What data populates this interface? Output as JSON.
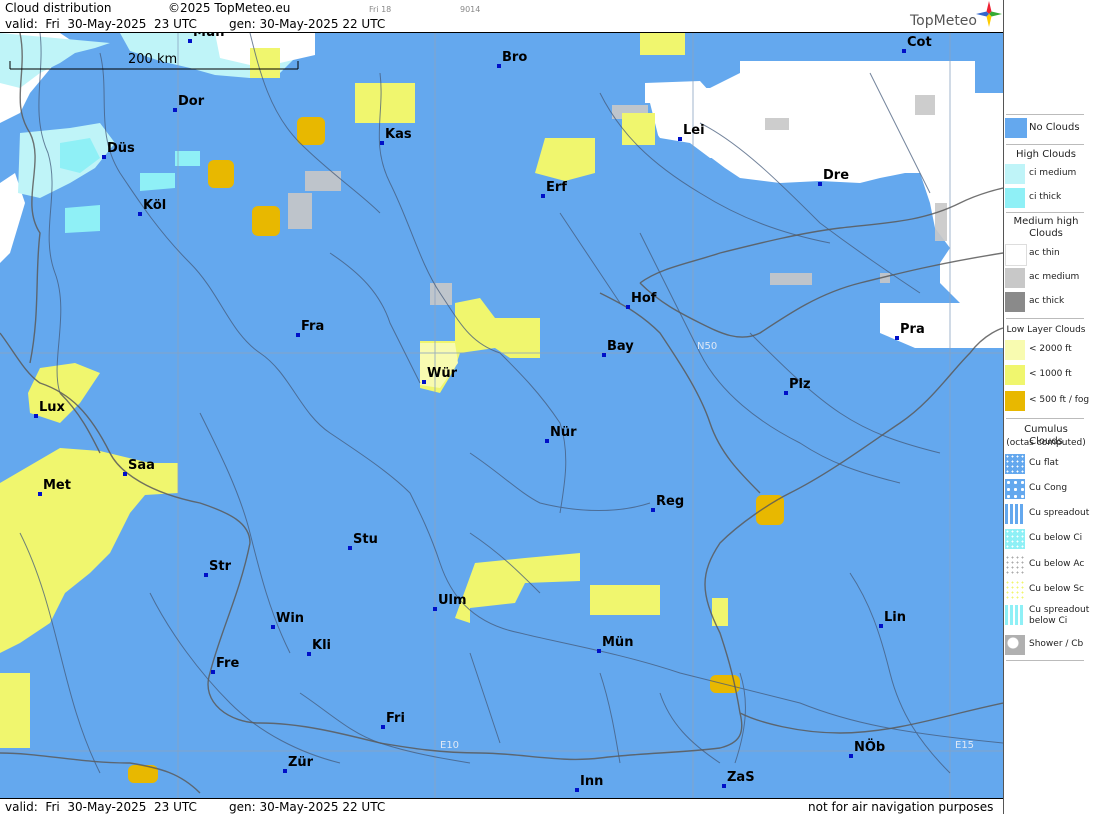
{
  "header": {
    "title": "Cloud distribution",
    "copyright": "©2025 TopMeteo.eu",
    "tiny1": "Fri 18",
    "tiny2": "9014",
    "valid": "valid:  Fri  30-May-2025  23 UTC",
    "gen": "gen: 30-May-2025 22 UTC",
    "logo": "TopMeteo"
  },
  "footer": {
    "valid": "valid:  Fri  30-May-2025  23 UTC",
    "gen": "gen: 30-May-2025 22 UTC",
    "disclaimer": "not for air navigation purposes"
  },
  "map": {
    "scale_label": "200 km",
    "grid_labels": [
      "N50",
      "E10",
      "E15"
    ],
    "cities": [
      {
        "id": "mun1",
        "name": "Mün"
      },
      {
        "id": "cot",
        "name": "Cot"
      },
      {
        "id": "bro",
        "name": "Bro"
      },
      {
        "id": "dor",
        "name": "Dor"
      },
      {
        "id": "kas",
        "name": "Kas"
      },
      {
        "id": "lei",
        "name": "Lei"
      },
      {
        "id": "dus",
        "name": "Düs"
      },
      {
        "id": "erf",
        "name": "Erf"
      },
      {
        "id": "dre",
        "name": "Dre"
      },
      {
        "id": "kol",
        "name": "Köl"
      },
      {
        "id": "hof",
        "name": "Hof"
      },
      {
        "id": "fra",
        "name": "Fra"
      },
      {
        "id": "pra",
        "name": "Pra"
      },
      {
        "id": "bay",
        "name": "Bay"
      },
      {
        "id": "wur",
        "name": "Wür"
      },
      {
        "id": "plz",
        "name": "Plz"
      },
      {
        "id": "lux",
        "name": "Lux"
      },
      {
        "id": "nur",
        "name": "Nür"
      },
      {
        "id": "saa",
        "name": "Saa"
      },
      {
        "id": "met",
        "name": "Met"
      },
      {
        "id": "reg",
        "name": "Reg"
      },
      {
        "id": "stu",
        "name": "Stu"
      },
      {
        "id": "str",
        "name": "Str"
      },
      {
        "id": "ulm",
        "name": "Ulm"
      },
      {
        "id": "win",
        "name": "Win"
      },
      {
        "id": "lin",
        "name": "Lin"
      },
      {
        "id": "kli",
        "name": "Kli"
      },
      {
        "id": "mun2",
        "name": "Mün"
      },
      {
        "id": "fre",
        "name": "Fre"
      },
      {
        "id": "fri",
        "name": "Fri"
      },
      {
        "id": "nob",
        "name": "NÖb"
      },
      {
        "id": "zur",
        "name": "Zür"
      },
      {
        "id": "zas",
        "name": "ZaS"
      },
      {
        "id": "inn",
        "name": "Inn"
      }
    ]
  },
  "legend": {
    "no_clouds": "No Clouds",
    "high": "High Clouds",
    "ci_medium": "ci medium",
    "ci_thick": "ci thick",
    "medium": "Medium high Clouds",
    "ac_thin": "ac thin",
    "ac_medium": "ac medium",
    "ac_thick": "ac thick",
    "low": "Low Layer Clouds",
    "low_2000": "< 2000 ft",
    "low_1000": "< 1000 ft",
    "low_500": "< 500 ft / fog",
    "cumulus": "Cumulus Clouds",
    "octas": "(octas computed)",
    "cu_flat": "Cu flat",
    "cu_cong": "Cu Cong",
    "cu_spreadout": "Cu spreadout",
    "cu_below_ci": "Cu below Ci",
    "cu_below_ac": "Cu below Ac",
    "cu_below_sc": "Cu below Sc",
    "cu_spreadout_ci_1": "Cu spreadout",
    "cu_spreadout_ci_2": "below Ci",
    "shower": "Shower / Cb"
  },
  "colors": {
    "no_clouds": "#64a8ee",
    "ci_medium": "#bff4f8",
    "ci_thick": "#8ff0f6",
    "ac_thin": "#ffffff",
    "ac_medium": "#c8c8c8",
    "ac_thick": "#8a8a8a",
    "low_2000": "#f8fbb0",
    "low_1000": "#f0f66e",
    "low_500": "#e8b800",
    "shower": "#b0b0b0"
  }
}
